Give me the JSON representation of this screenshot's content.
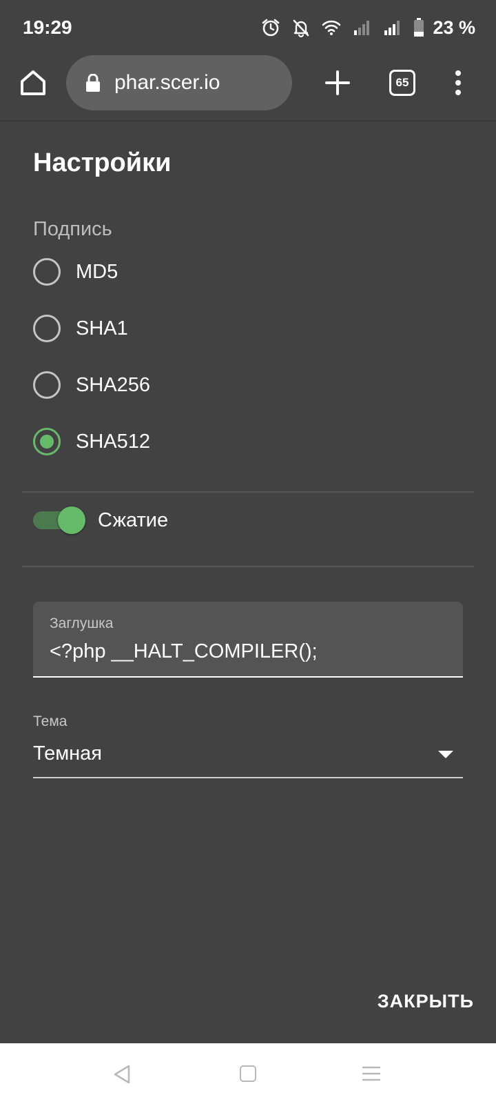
{
  "status_bar": {
    "time": "19:29",
    "battery_percent": "23 %",
    "icons": [
      "alarm-icon",
      "notifications-off-icon",
      "wifi-icon",
      "signal-icon",
      "signal-icon",
      "battery-icon"
    ]
  },
  "browser": {
    "url": "phar.scer.io",
    "tab_count": "65",
    "icons": [
      "home-icon",
      "lock-icon",
      "plus-icon",
      "tabs-icon",
      "more-vert-icon"
    ]
  },
  "dialog": {
    "title": "Настройки",
    "signature_label": "Подпись",
    "signature_options": [
      {
        "label": "MD5",
        "checked": false
      },
      {
        "label": "SHA1",
        "checked": false
      },
      {
        "label": "SHA256",
        "checked": false
      },
      {
        "label": "SHA512",
        "checked": true
      }
    ],
    "compression": {
      "label": "Сжатие",
      "enabled": true
    },
    "stub": {
      "label": "Заглушка",
      "value": "<?php __HALT_COMPILER();"
    },
    "theme": {
      "label": "Тема",
      "value": "Темная"
    },
    "close_label": "ЗАКРЫТЬ"
  },
  "colors": {
    "background": "#424242",
    "accent": "#66bb6a",
    "url_bar": "#616161",
    "nav_bar": "#ffffff"
  }
}
